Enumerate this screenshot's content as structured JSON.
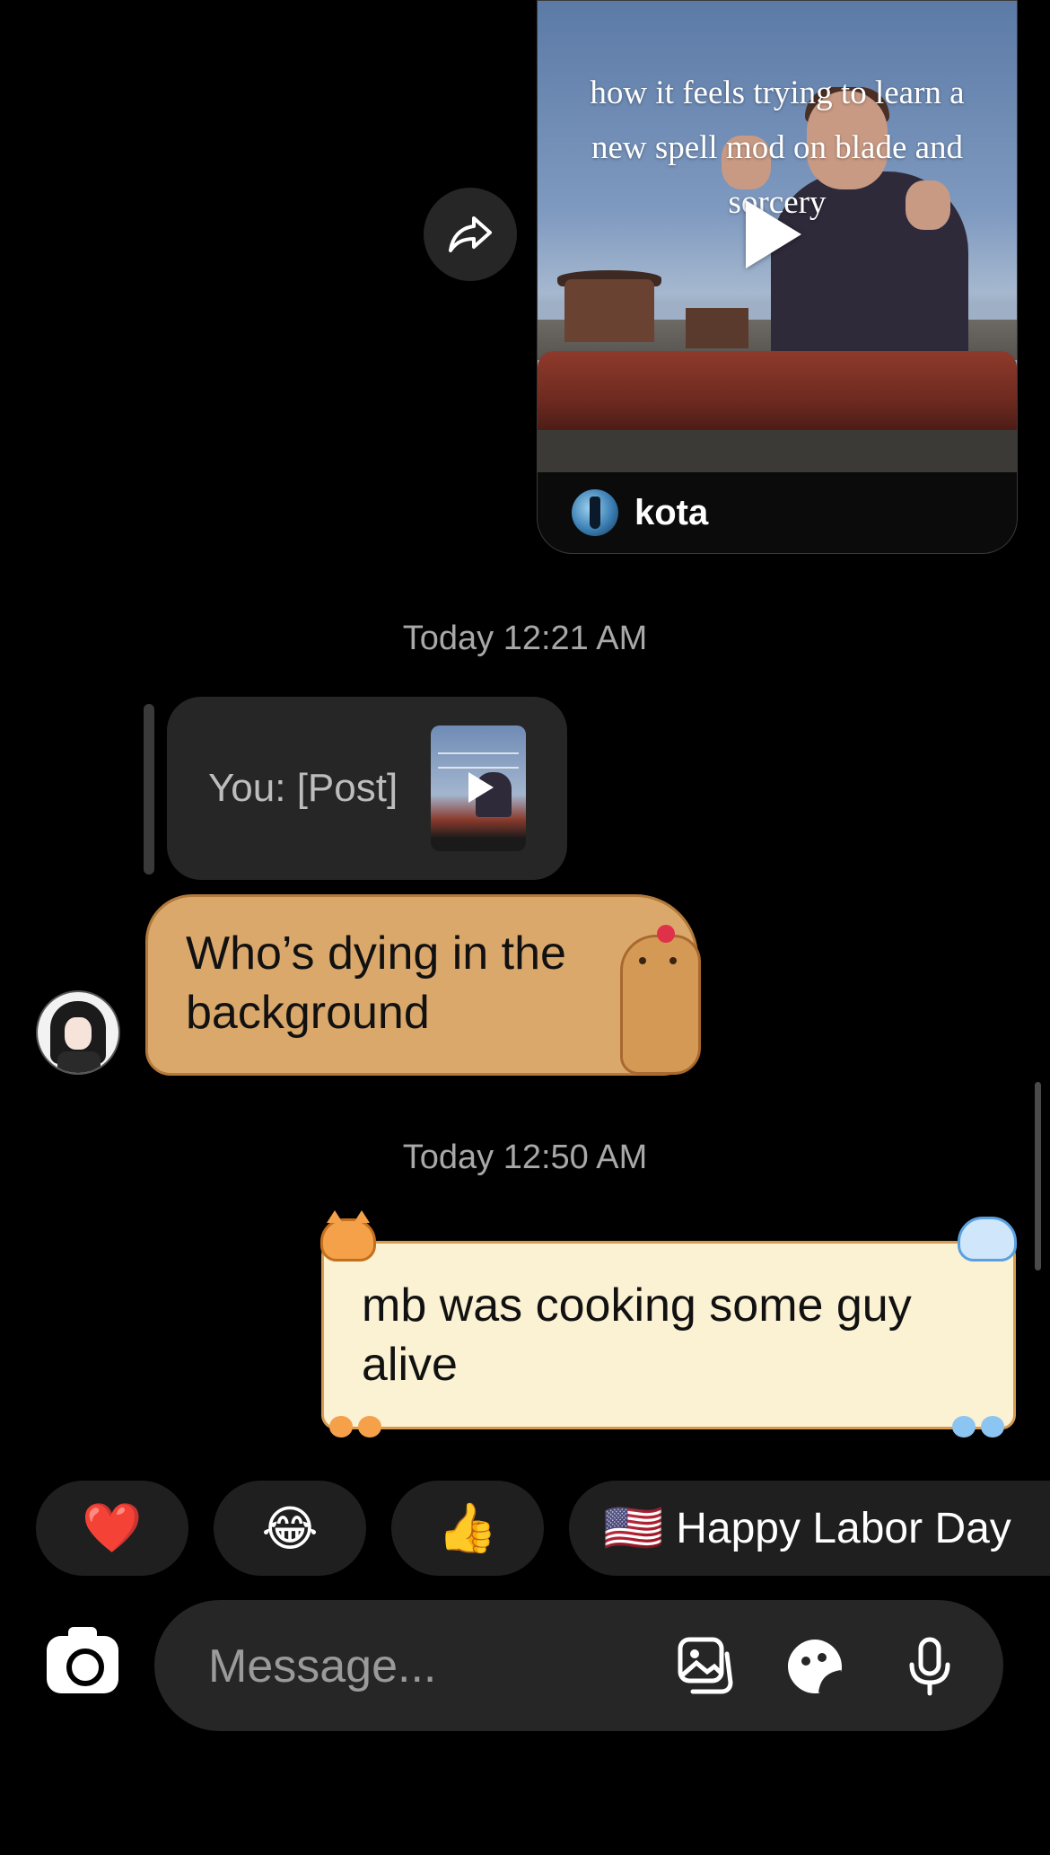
{
  "shared_post": {
    "caption": "how it feels trying to learn a new spell mod on blade and sorcery",
    "author": "kota"
  },
  "timestamps": {
    "first": "Today 12:21 AM",
    "second": "Today 12:50 AM"
  },
  "reply": {
    "preview_text": "You: [Post]"
  },
  "messages": {
    "incoming": "Who’s dying in the background",
    "outgoing": "mb was cooking some guy alive"
  },
  "quick_reactions": {
    "heart": "❤️",
    "laugh": "😂",
    "thumbs": "👍",
    "holiday_emoji": "🇺🇸",
    "holiday_label": "Happy Labor Day"
  },
  "composer": {
    "placeholder": "Message..."
  }
}
